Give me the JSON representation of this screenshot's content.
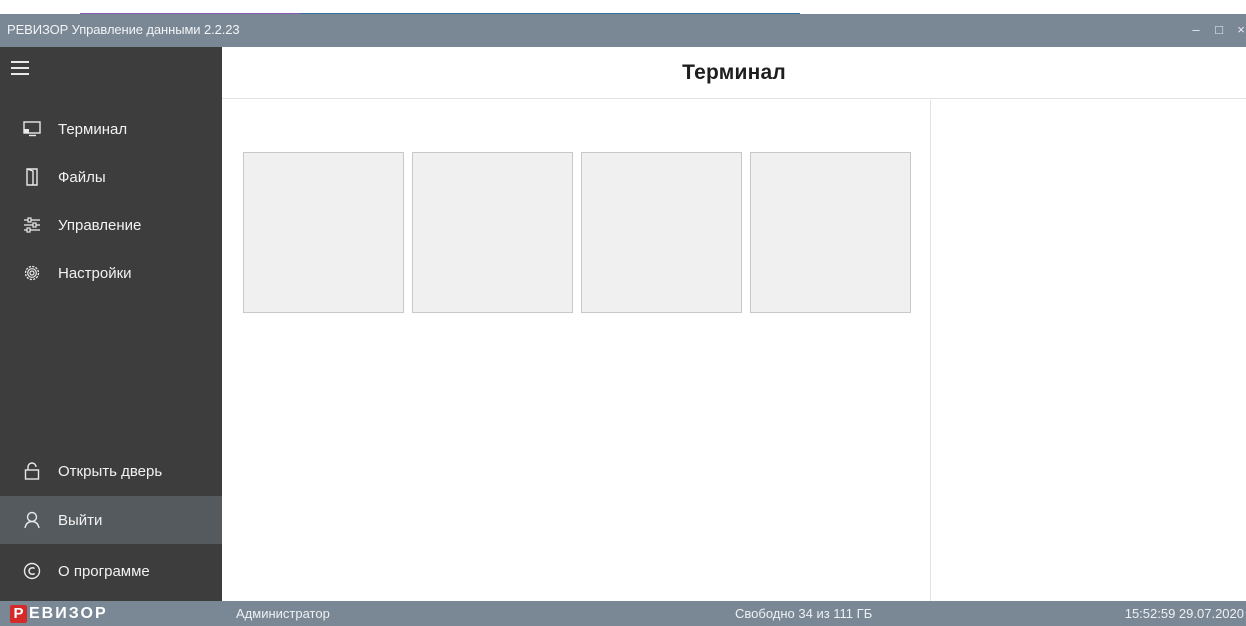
{
  "window": {
    "title": "РЕВИЗОР Управление данными 2.2.23",
    "controls": [
      "–",
      "□",
      "×"
    ]
  },
  "sidebar": {
    "menu_icon": "hamburger-icon",
    "items": [
      {
        "label": "Терминал",
        "icon": "monitor-icon"
      },
      {
        "label": "Файлы",
        "icon": "door-icon"
      },
      {
        "label": "Управление",
        "icon": "sliders-icon"
      },
      {
        "label": "Настройки",
        "icon": "gear-icon"
      }
    ],
    "bottom_items": [
      {
        "label": "Открыть дверь",
        "icon": "unlock-icon",
        "active": false
      },
      {
        "label": "Выйти",
        "icon": "user-icon",
        "active": true
      },
      {
        "label": "О программе",
        "icon": "copyright-icon",
        "active": false
      }
    ]
  },
  "header": {
    "title": "Терминал"
  },
  "terminal": {
    "tiles": [
      "",
      "",
      "",
      ""
    ]
  },
  "statusbar": {
    "logo_letter": "Р",
    "logo_word": "ЕВИЗОР",
    "user": "Администратор",
    "free_space": "Свободно 34 из 111 ГБ",
    "datetime": "15:52:59 29.07.2020"
  },
  "colors": {
    "titlebar": "#7a8794",
    "sidebar": "#3d3d3d",
    "sidebar_active": "#555a5f",
    "tile": "#f0f0f0",
    "logo_red": "#d42a2a"
  }
}
